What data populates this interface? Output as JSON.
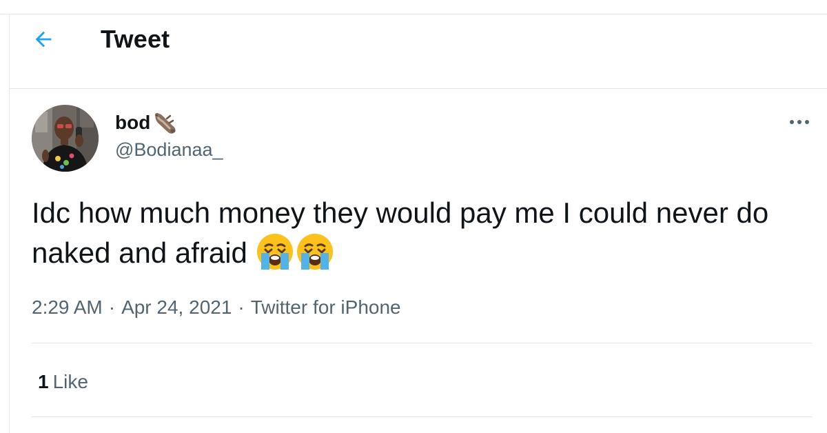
{
  "header": {
    "title": "Tweet",
    "back_icon": "arrow-left-icon",
    "accent_color": "#1da1f2"
  },
  "author": {
    "display_name": "bod",
    "name_emoji_icon": "otter-emoji-icon",
    "handle": "@Bodianaa_",
    "avatar_icon": "avatar-photo"
  },
  "more_icon": "more-dots-icon",
  "tweet": {
    "text": "Idc how much money they would pay me I could never do naked and afraid",
    "emojis": [
      "loudly-crying-face-emoji",
      "loudly-crying-face-emoji"
    ]
  },
  "meta": {
    "time": "2:29 AM",
    "separator": "·",
    "date": "Apr 24, 2021",
    "source": "Twitter for iPhone"
  },
  "stats": {
    "likes_count": "1",
    "likes_label": "Like"
  }
}
